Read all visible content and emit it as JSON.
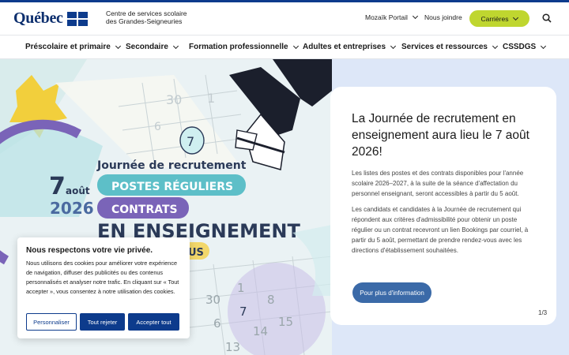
{
  "header": {
    "logo_text": "Québec",
    "org_line1": "Centre de services scolaire",
    "org_line2": "des Grandes-Seigneuries",
    "links": [
      "Mozaïk Portail",
      "Nous joindre"
    ],
    "cta_label": "Carrières",
    "accent_color": "#bfd62f"
  },
  "nav": {
    "items": [
      "Préscolaire et primaire",
      "Secondaire",
      "Formation professionnelle",
      "Adultes et entreprises",
      "Services et ressources",
      "CSSDGS"
    ]
  },
  "hero": {
    "poster": {
      "line1": "Journée de recrutement",
      "day": "7",
      "month": "août",
      "year": "2026",
      "pill1": "POSTES RÉGULIERS",
      "pill2": "CONTRATS",
      "line_big": "EN ENSEIGNEMENT",
      "suffix": "US"
    },
    "card": {
      "title": "La Journée de recrutement en enseignement aura lieu le 7 août 2026!",
      "para1": "Les listes des postes et des contrats disponibles pour l'année scolaire 2026–2027, à la suite de la séance d'affectation du personnel enseignant, seront accessibles à partir du 5 août.",
      "para2": "Les candidats et candidates à la Journée de recrutement qui répondent aux critères d'admissibilité pour obtenir un poste régulier ou un contrat recevront un lien Bookings par courriel, à partir du 5 août, permettant de prendre rendez-vous avec les directions d'établissement souhaitées.",
      "button": "Pour plus d'information",
      "pager": "1/3"
    }
  },
  "cookie": {
    "title": "Nous respectons votre vie privée.",
    "text": "Nous utilisons des cookies pour améliorer votre expérience de navigation, diffuser des publicités ou des contenus personnalisés et analyser notre trafic. En cliquant sur « Tout accepter », vous consentez à notre utilisation des cookies.",
    "btn_customize": "Personnaliser",
    "btn_reject": "Tout rejeter",
    "btn_accept": "Accepter tout"
  }
}
